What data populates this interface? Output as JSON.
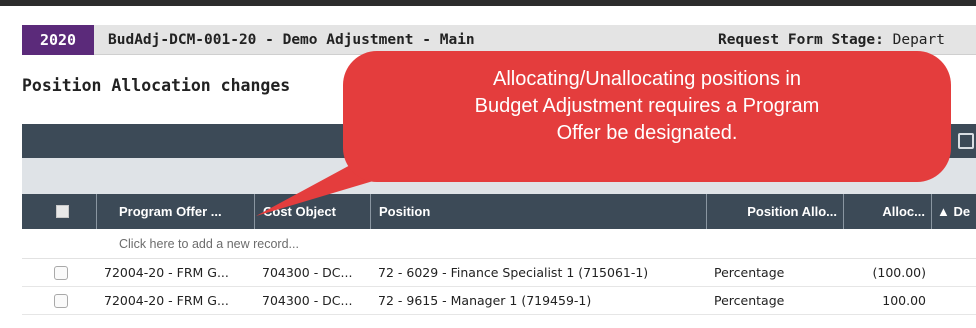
{
  "header": {
    "year": "2020",
    "request_title": "BudAdj-DCM-001-20 - Demo Adjustment - Main",
    "stage_label": "Request Form Stage:",
    "stage_value": "Depart"
  },
  "section_title": "Position Allocation changes",
  "callout": {
    "lines": [
      "Allocating/Unallocating positions in",
      "Budget Adjustment requires a Program",
      "Offer be designated."
    ],
    "color": "#e43d3d"
  },
  "grid": {
    "columns": [
      "Program Offer ...",
      "Cost Object",
      "Position",
      "Position Allo...",
      "Alloc...",
      "▲ De"
    ],
    "add_record": "Click here to add a new record...",
    "rows": [
      {
        "program_offer": "72004-20 - FRM G...",
        "cost_object": "704300 - DC...",
        "position": "72 - 6029 - Finance Specialist 1 (715061-1)",
        "allocation_type": "Percentage",
        "allocation": "(100.00)"
      },
      {
        "program_offer": "72004-20 - FRM G...",
        "cost_object": "704300 - DC...",
        "position": "72 - 9615 - Manager 1 (719459-1)",
        "allocation_type": "Percentage",
        "allocation": "100.00"
      }
    ]
  },
  "colors": {
    "year_badge": "#5b2a7a",
    "grid_header": "#3c4a57",
    "callout": "#e43d3d"
  }
}
